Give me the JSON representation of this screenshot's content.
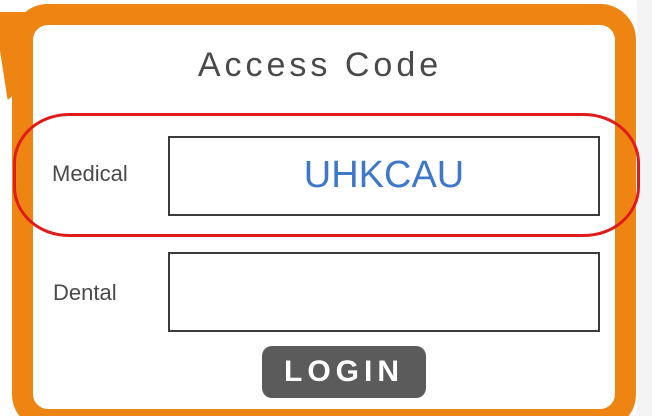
{
  "access_panel": {
    "title": "Access Code",
    "medical_label": "Medical",
    "medical_code": "UHKCAU",
    "dental_label": "Dental",
    "dental_code": "",
    "login_label": "LOGIN"
  },
  "colors": {
    "frame": "#ee8512",
    "highlight": "#e01b1b",
    "code_text": "#3f78c8",
    "button": "#5b5b5b"
  }
}
